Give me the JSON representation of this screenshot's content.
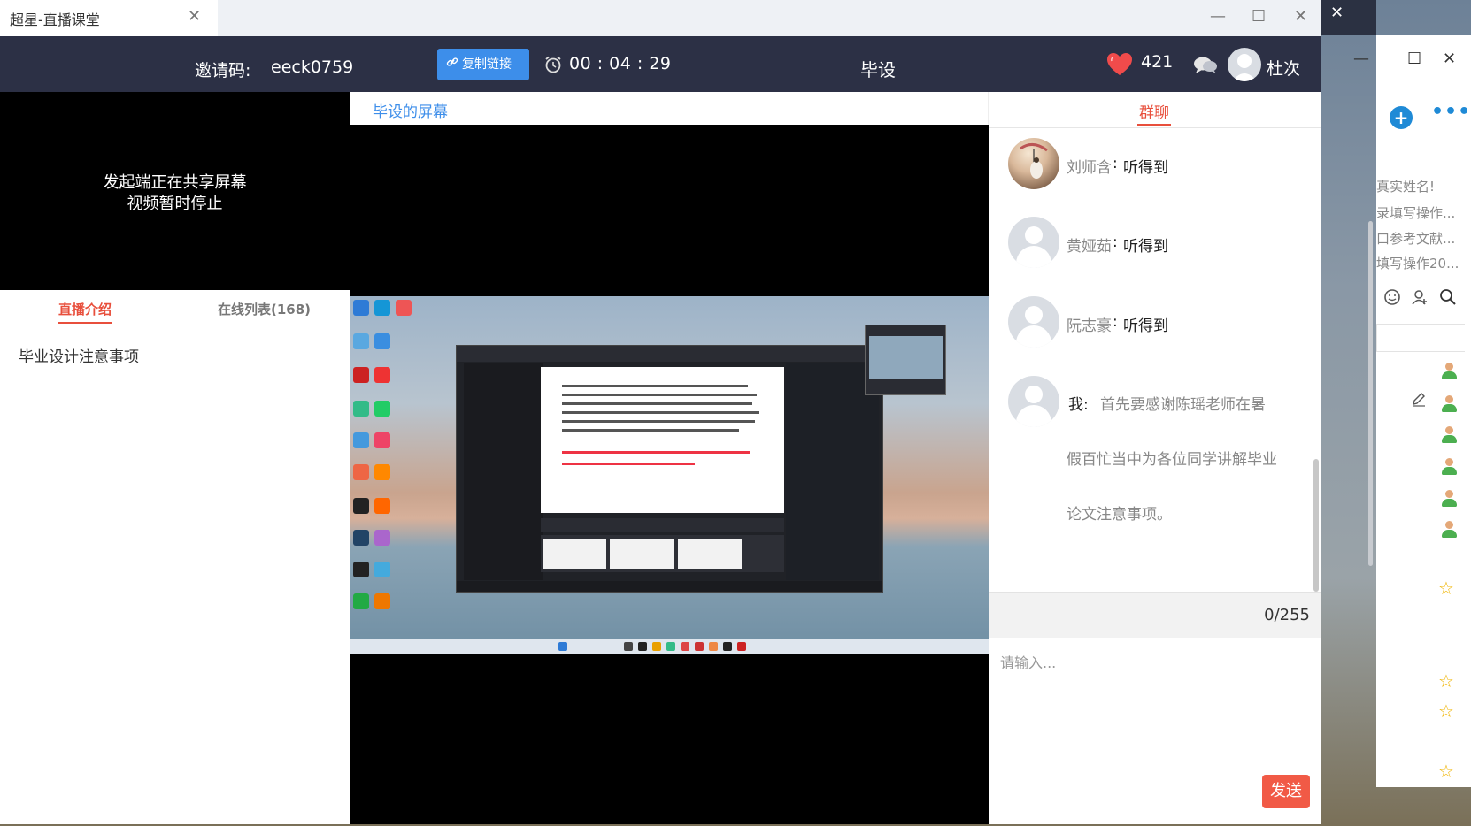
{
  "window": {
    "tab_title": "超星-直播课堂",
    "tab_close": "✕",
    "minimize": "—",
    "maximize": "☐",
    "close": "✕"
  },
  "header": {
    "invite_label": "邀请码:",
    "invite_code": "eeck0759",
    "copy_link_label": "复制链接",
    "timer": "00 : 04 : 29",
    "course_name": "毕设",
    "likes": "421",
    "user_name": "杜次"
  },
  "left": {
    "video_message_line1": "发起端正在共享屏幕",
    "video_message_line2": "视频暂时停止",
    "tabs": [
      {
        "label": "直播介绍",
        "active": true
      },
      {
        "label": "在线列表(168)",
        "active": false
      }
    ],
    "intro_text": "毕业设计注意事项"
  },
  "center": {
    "screen_label": "毕设的屏幕"
  },
  "chat": {
    "tab_label": "群聊",
    "messages": [
      {
        "name": "刘师含",
        "separator": ":",
        "text": "听得到"
      },
      {
        "name": "黄娅茹",
        "separator": ":",
        "text": "听得到"
      },
      {
        "name": "阮志豪",
        "separator": ":",
        "text": "听得到"
      }
    ],
    "self_message": {
      "label": "我:",
      "line1": "首先要感谢陈瑶老师在暑",
      "line2": "假百忙当中为各位同学讲解毕业",
      "line3": "论文注意事项。"
    },
    "counter": "0/255",
    "input_placeholder": "请输入...",
    "send_label": "发送"
  },
  "background_app": {
    "close": "✕",
    "minimize": "—",
    "maximize": "☐",
    "close2": "✕",
    "plus": "+",
    "more": "•••",
    "lines": [
      "真实姓名!",
      "录填写操作...",
      "口参考文献...",
      "填写操作20..."
    ]
  },
  "colors": {
    "accent_red": "#e84f3c",
    "accent_blue": "#3d8eea",
    "topbar_bg": "#2c3045",
    "send_button": "#f15a46"
  }
}
